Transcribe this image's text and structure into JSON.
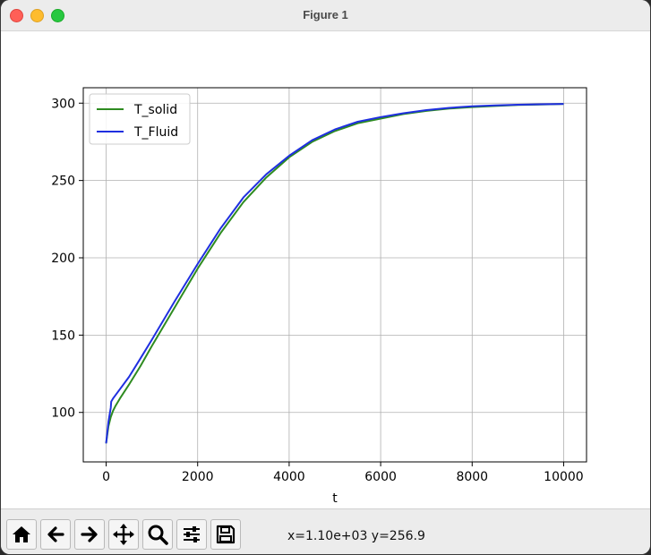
{
  "window": {
    "title": "Figure 1"
  },
  "toolbar": {
    "buttons": [
      {
        "name": "home-icon"
      },
      {
        "name": "back-arrow-icon"
      },
      {
        "name": "forward-arrow-icon"
      },
      {
        "name": "pan-icon"
      },
      {
        "name": "zoom-icon"
      },
      {
        "name": "configure-subplots-icon"
      },
      {
        "name": "save-icon"
      }
    ],
    "coords": "x=1.10e+03 y=256.9"
  },
  "chart_data": {
    "type": "line",
    "xlabel": "t",
    "ylabel": "",
    "xlim": [
      -500,
      10500
    ],
    "ylim": [
      68,
      310
    ],
    "xticks": [
      0,
      2000,
      4000,
      6000,
      8000,
      10000
    ],
    "yticks": [
      100,
      150,
      200,
      250,
      300
    ],
    "grid": true,
    "legend_position": "top-left",
    "series": [
      {
        "name": "T_solid",
        "color": "#2e8b20",
        "x": [
          0,
          50,
          100,
          150,
          200,
          300,
          500,
          750,
          1000,
          1500,
          2000,
          2500,
          3000,
          3500,
          4000,
          4500,
          5000,
          5500,
          6000,
          6500,
          7000,
          7500,
          8000,
          8500,
          9000,
          9500,
          10000
        ],
        "y": [
          80,
          91,
          97,
          101,
          104,
          109,
          118,
          130,
          143,
          168,
          193,
          216,
          236,
          252,
          265,
          275,
          282,
          287,
          290,
          293,
          295,
          296.5,
          297.5,
          298.2,
          298.8,
          299.2,
          299.5
        ]
      },
      {
        "name": "T_Fluid",
        "color": "#1f2fe0",
        "x": [
          0,
          50,
          100,
          110,
          150,
          200,
          300,
          500,
          750,
          1000,
          1500,
          2000,
          2500,
          3000,
          3500,
          4000,
          4500,
          5000,
          5500,
          6000,
          6500,
          7000,
          7500,
          8000,
          8500,
          9000,
          9500,
          10000
        ],
        "y": [
          80,
          94,
          103,
          107,
          109,
          111,
          115,
          123,
          135,
          147,
          172,
          196,
          219,
          239,
          254,
          266,
          276,
          283,
          288,
          291,
          293.5,
          295.5,
          297,
          298,
          298.6,
          299,
          299.3,
          299.5
        ]
      }
    ]
  }
}
